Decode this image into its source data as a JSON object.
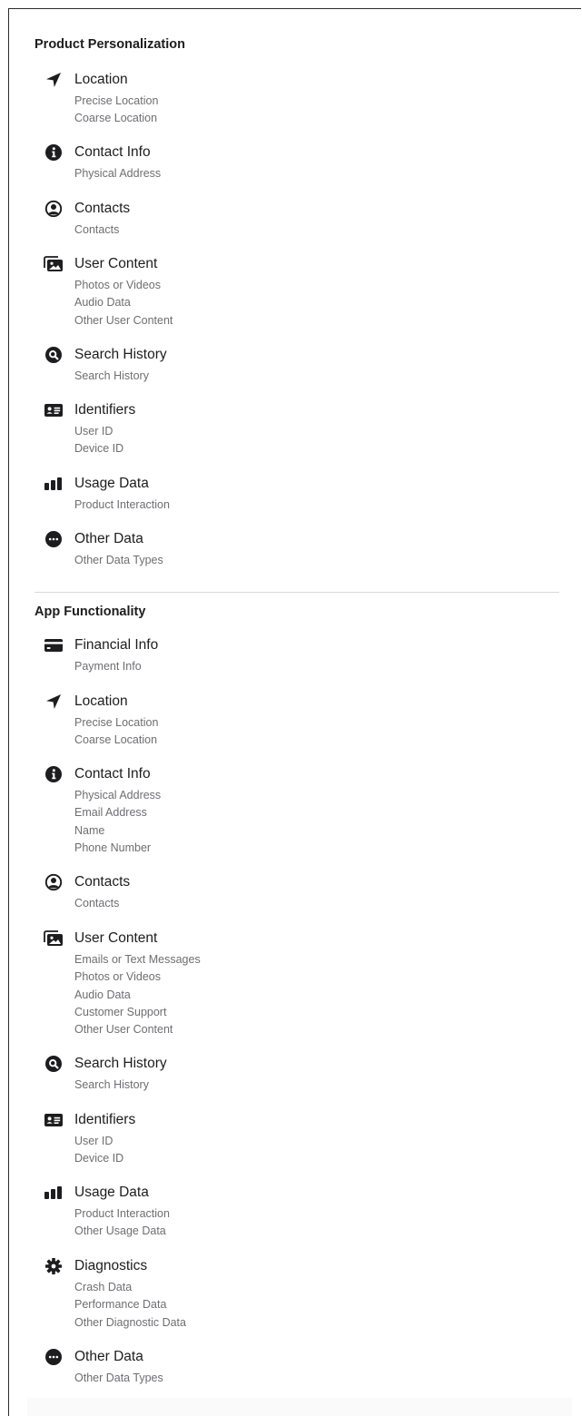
{
  "sections": [
    {
      "title": "Product Personalization",
      "items": [
        {
          "icon": "location-arrow-icon",
          "label": "Location",
          "subs": [
            "Precise Location",
            "Coarse Location"
          ]
        },
        {
          "icon": "info-circle-icon",
          "label": "Contact Info",
          "subs": [
            "Physical Address"
          ]
        },
        {
          "icon": "person-circle-icon",
          "label": "Contacts",
          "subs": [
            "Contacts"
          ]
        },
        {
          "icon": "photos-icon",
          "label": "User Content",
          "subs": [
            "Photos or Videos",
            "Audio Data",
            "Other User Content"
          ]
        },
        {
          "icon": "search-circle-icon",
          "label": "Search History",
          "subs": [
            "Search History"
          ]
        },
        {
          "icon": "id-card-icon",
          "label": "Identifiers",
          "subs": [
            "User ID",
            "Device ID"
          ]
        },
        {
          "icon": "bar-chart-icon",
          "label": "Usage Data",
          "subs": [
            "Product Interaction"
          ]
        },
        {
          "icon": "ellipsis-circle-icon",
          "label": "Other Data",
          "subs": [
            "Other Data Types"
          ]
        }
      ]
    },
    {
      "title": "App Functionality",
      "items": [
        {
          "icon": "credit-card-icon",
          "label": "Financial Info",
          "subs": [
            "Payment Info"
          ]
        },
        {
          "icon": "location-arrow-icon",
          "label": "Location",
          "subs": [
            "Precise Location",
            "Coarse Location"
          ]
        },
        {
          "icon": "info-circle-icon",
          "label": "Contact Info",
          "subs": [
            "Physical Address",
            "Email Address",
            "Name",
            "Phone Number"
          ]
        },
        {
          "icon": "person-circle-icon",
          "label": "Contacts",
          "subs": [
            "Contacts"
          ]
        },
        {
          "icon": "photos-icon",
          "label": "User Content",
          "subs": [
            "Emails or Text Messages",
            "Photos or Videos",
            "Audio Data",
            "Customer Support",
            "Other User Content"
          ]
        },
        {
          "icon": "search-circle-icon",
          "label": "Search History",
          "subs": [
            "Search History"
          ]
        },
        {
          "icon": "id-card-icon",
          "label": "Identifiers",
          "subs": [
            "User ID",
            "Device ID"
          ]
        },
        {
          "icon": "bar-chart-icon",
          "label": "Usage Data",
          "subs": [
            "Product Interaction",
            "Other Usage Data"
          ]
        },
        {
          "icon": "gear-icon",
          "label": "Diagnostics",
          "subs": [
            "Crash Data",
            "Performance Data",
            "Other Diagnostic Data"
          ]
        },
        {
          "icon": "ellipsis-circle-icon",
          "label": "Other Data",
          "subs": [
            "Other Data Types"
          ]
        }
      ]
    }
  ]
}
